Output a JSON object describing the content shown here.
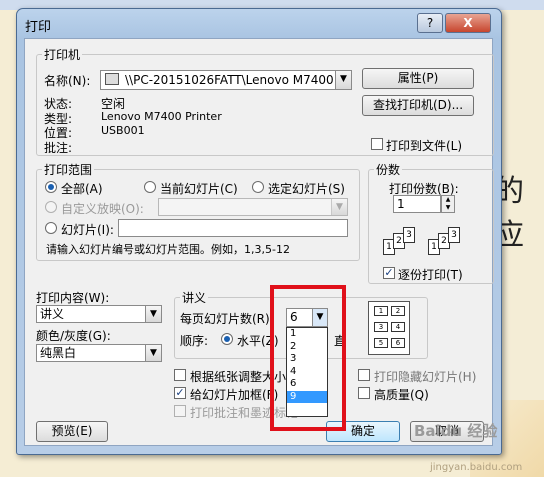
{
  "dialog": {
    "title": "打印",
    "help": "?",
    "close": "X"
  },
  "printer": {
    "group_label": "打印机",
    "name_label": "名称(N):",
    "name_value": "\\\\PC-20151026FATT\\Lenovo M7400 ...",
    "properties": "属性(P)",
    "find_printer": "查找打印机(D)...",
    "print_to_file": "打印到文件(L)",
    "status_label": "状态:",
    "status_value": "空闲",
    "type_label": "类型:",
    "type_value": "Lenovo M7400 Printer",
    "where_label": "位置:",
    "where_value": "USB001",
    "comment_label": "批注:"
  },
  "range": {
    "group_label": "打印范围",
    "all": "全部(A)",
    "current": "当前幻灯片(C)",
    "selection": "选定幻灯片(S)",
    "custom_show": "自定义放映(O):",
    "slides": "幻灯片(I):",
    "hint": "请输入幻灯片编号或幻灯片范围。例如，1,3,5-12"
  },
  "copies": {
    "group_label": "份数",
    "count_label": "打印份数(B):",
    "count_value": "1",
    "collate": "逐份打印(T)"
  },
  "print_what": {
    "label": "打印内容(W):",
    "value": "讲义"
  },
  "color": {
    "label": "颜色/灰度(G):",
    "value": "纯黑白"
  },
  "handouts": {
    "group_label": "讲义",
    "per_page_label": "每页幻灯片数(R):",
    "per_page_value": "6",
    "options": [
      "1",
      "2",
      "3",
      "4",
      "6",
      "9"
    ],
    "selected_option": "9",
    "order_label": "顺序:",
    "horizontal": "水平(Z)",
    "vertical_fragment": "直"
  },
  "options": {
    "scale": "根据纸张调整大小",
    "frame": "给幻灯片加框(F)",
    "comments": "打印批注和墨迹标记",
    "hidden": "打印隐藏幻灯片(H)",
    "high_quality": "高质量(Q)"
  },
  "buttons": {
    "preview": "预览(E)",
    "ok": "确定",
    "cancel": "取消"
  },
  "background": {
    "text": "的应",
    "watermark": "Baidu 经验",
    "url": "jingyan.baidu.com"
  }
}
